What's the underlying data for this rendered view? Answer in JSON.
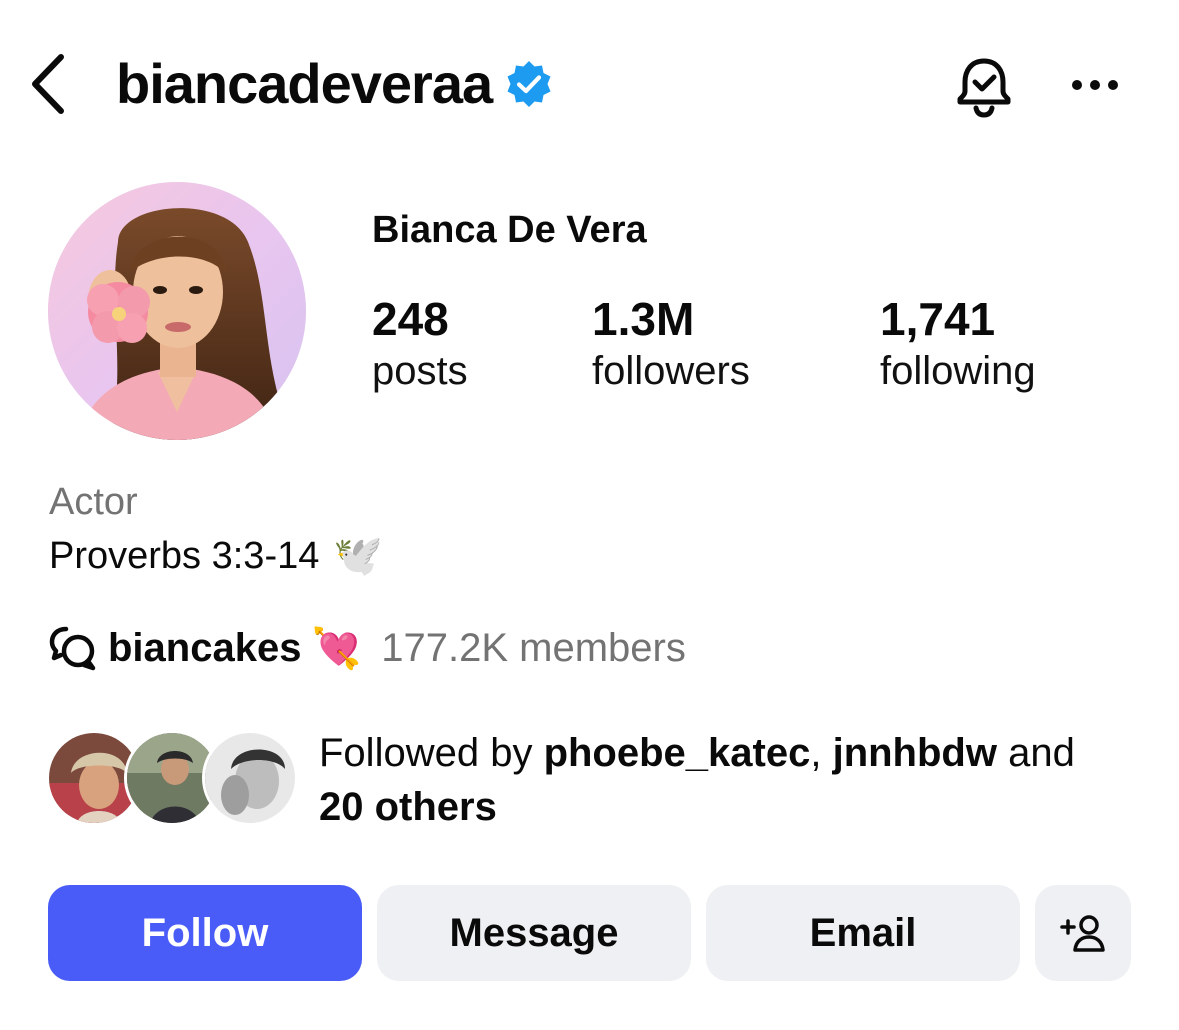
{
  "header": {
    "username": "biancadeveraa",
    "verified": true,
    "icons": [
      "back-chevron-icon",
      "verified-badge-icon",
      "notification-bell-icon",
      "more-options-icon"
    ]
  },
  "profile": {
    "full_name": "Bianca De Vera",
    "stats": [
      {
        "value": "248",
        "label": "posts"
      },
      {
        "value": "1.3M",
        "label": "followers"
      },
      {
        "value": "1,741",
        "label": "following"
      }
    ]
  },
  "bio": {
    "category": "Actor",
    "text": "Proverbs 3:3-14",
    "emoji": "🕊️"
  },
  "channel": {
    "name": "biancakes",
    "emoji": "💘",
    "members": "177.2K members"
  },
  "followed_by": {
    "prefix": "Followed by ",
    "user1": "phoebe_katec",
    "separator": ", ",
    "user2": "jnnhbdw",
    "conjunction": " and",
    "others": "20 others"
  },
  "actions": {
    "follow": "Follow",
    "message": "Message",
    "email": "Email"
  },
  "colors": {
    "follow_button": "#4a5cf7",
    "secondary_button": "#eef0f3",
    "verified_badge": "#1d9bf0",
    "muted_text": "#737373"
  }
}
